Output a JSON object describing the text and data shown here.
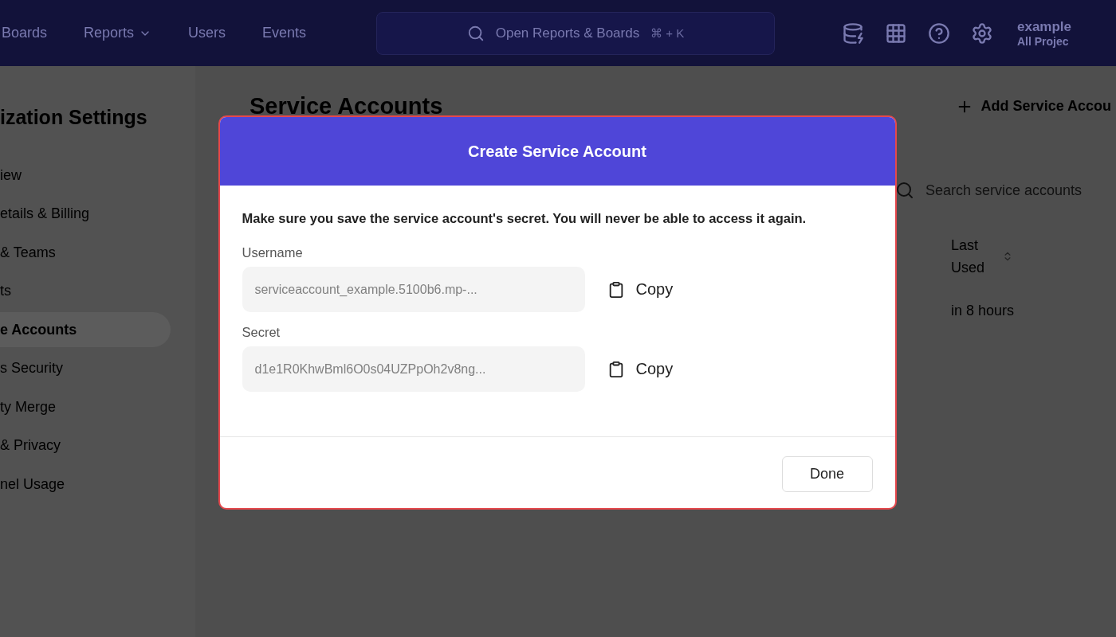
{
  "top_nav": {
    "items": [
      {
        "label": "Boards",
        "dropdown": false
      },
      {
        "label": "Reports",
        "dropdown": true
      },
      {
        "label": "Users",
        "dropdown": false
      },
      {
        "label": "Events",
        "dropdown": false
      }
    ],
    "search": {
      "placeholder": "Open Reports & Boards",
      "shortcut": "⌘ + K"
    },
    "account": {
      "name": "example",
      "project": "All Projec"
    }
  },
  "sidebar": {
    "title": "ization Settings",
    "items": [
      {
        "label": "iew",
        "selected": false
      },
      {
        "label": "etails & Billing",
        "selected": false
      },
      {
        "label": "& Teams",
        "selected": false
      },
      {
        "label": "ts",
        "selected": false
      },
      {
        "label": "e Accounts",
        "selected": true
      },
      {
        "label": "s Security",
        "selected": false
      },
      {
        "label": "ty Merge",
        "selected": false
      },
      {
        "label": "& Privacy",
        "selected": false
      },
      {
        "label": "nel Usage",
        "selected": false
      }
    ]
  },
  "main": {
    "title": "Service Accounts",
    "add_button": "Add Service Accou",
    "search": {
      "placeholder": "Search service accounts"
    },
    "table": {
      "columns": [
        "Last Used"
      ],
      "rows": [
        [
          "in 8 hours"
        ]
      ]
    }
  },
  "dialog": {
    "title": "Create Service Account",
    "message": "Make sure you save the service account's secret. You will never be able to access it again.",
    "fields": [
      {
        "label": "Username",
        "value": "serviceaccount_example.5100b6.mp-...",
        "action": "Copy"
      },
      {
        "label": "Secret",
        "value": "d1e1R0KhwBml6O0s04UZPpOh2v8ng...",
        "action": "Copy"
      }
    ],
    "done": "Done"
  }
}
